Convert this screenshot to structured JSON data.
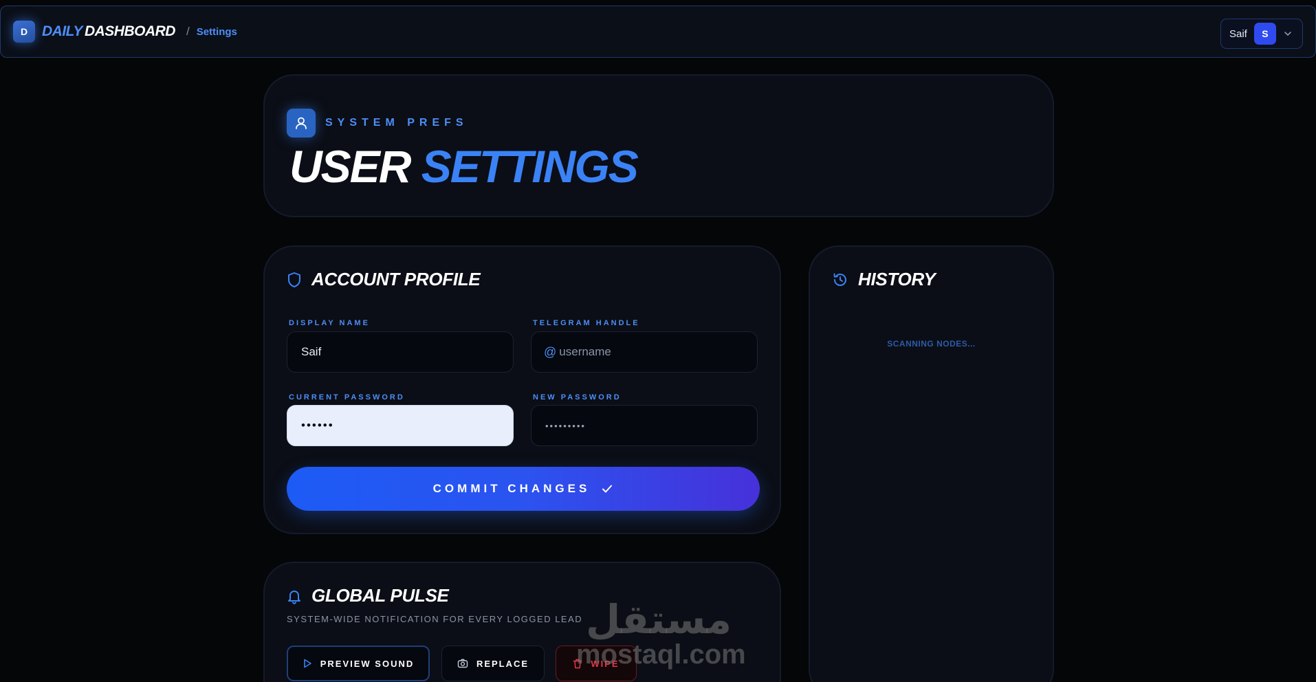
{
  "header": {
    "logo_letter": "D",
    "brand_part1": "DAILY",
    "brand_part2": "DASHBOARD",
    "breadcrumb_sep": "/",
    "breadcrumb_current": "Settings",
    "user_name": "Saif",
    "user_initial": "S"
  },
  "hero": {
    "kicker": "SYSTEM PREFS",
    "title_part1": "USER",
    "title_part2": "SETTINGS"
  },
  "account_profile": {
    "title": "ACCOUNT PROFILE",
    "display_name_label": "DISPLAY NAME",
    "display_name_value": "Saif",
    "telegram_label": "TELEGRAM HANDLE",
    "telegram_prefix": "@",
    "telegram_placeholder": "username",
    "current_password_label": "CURRENT PASSWORD",
    "current_password_value": "••••••",
    "new_password_label": "NEW PASSWORD",
    "new_password_placeholder": "•••••••••",
    "commit_label": "COMMIT CHANGES"
  },
  "history": {
    "title": "HISTORY",
    "status": "SCANNING NODES..."
  },
  "global_pulse": {
    "title": "GLOBAL PULSE",
    "subtitle": "SYSTEM-WIDE NOTIFICATION FOR EVERY LOGGED LEAD",
    "preview_label": "PREVIEW SOUND",
    "replace_label": "REPLACE",
    "wipe_label": "WIPE"
  },
  "watermark": {
    "arabic": "مستقل",
    "latin": "mostaql.com"
  },
  "colors": {
    "accent": "#3a82f6",
    "background": "#050608",
    "card": "#0b0e16",
    "danger": "#e53945"
  }
}
